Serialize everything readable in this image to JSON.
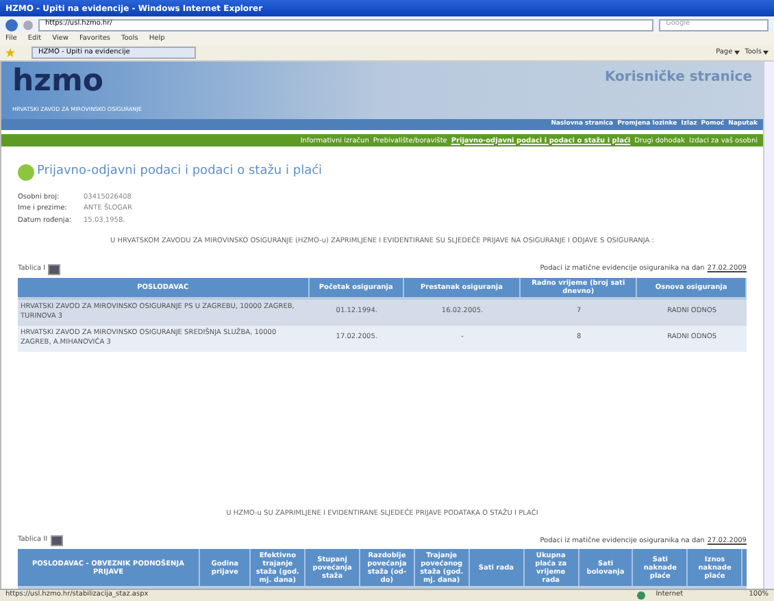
{
  "window": {
    "title": "HZMO - Upiti na evidencije - Windows Internet Explorer"
  },
  "browser": {
    "address": "https://usl.hzmo.hr/",
    "search_placeholder": "Google",
    "menu": [
      "File",
      "Edit",
      "View",
      "Favorites",
      "Tools",
      "Help"
    ],
    "tab": "HZMO - Upiti na evidencije",
    "tools": [
      "Page",
      "Tools"
    ]
  },
  "site": {
    "logo": "hzmo",
    "logo_subtitle": "HRVATSKI ZAVOD ZA MIROVINSKO OSIGURANJE",
    "heading": "Korisničke stranice",
    "top_nav": [
      "Naslovna stranica",
      "Promjena lozinke",
      "Izlaz",
      "Pomoć",
      "Naputak"
    ],
    "main_nav": [
      {
        "label": "Informativni izračun",
        "selected": false
      },
      {
        "label": "Prebivalište/boravište",
        "selected": false
      },
      {
        "label": "Prijavno-odjavni podaci i podaci o stažu i plaći",
        "selected": true
      },
      {
        "label": "Drugi dohodak",
        "selected": false
      },
      {
        "label": "Izdaci za vaš osobni",
        "selected": false
      }
    ]
  },
  "page": {
    "title": "Prijavno-odjavni podaci i podaci o stažu i plaći",
    "fields": [
      {
        "label": "Osobni broj:",
        "value": "03415026408"
      },
      {
        "label": "Ime i prezime:",
        "value": "ANTE ŠLOGAR"
      },
      {
        "label": "Datum rođenja:",
        "value": "15.03.1958."
      }
    ],
    "sections": [
      {
        "notice": "U HRVATSKOM ZAVODU ZA MIROVINSKO OSIGURANJE (HZMO-u) ZAPRIMLJENE I EVIDENTIRANE SU SLJEDEĆE PRIJAVE NA OSIGURANJE I ODJAVE S OSIGURANJA :",
        "table_label": "Tablica I",
        "as_of": "Podaci iz matične evidencije osiguranika na dan",
        "as_of_date": "27.02.2009",
        "columns": [
          "POSLODAVAC",
          "Početak osiguranja",
          "Prestanak osiguranja",
          "Radno vrijeme (broj sati dnevno)",
          "Osnova osiguranja"
        ],
        "rows": [
          [
            "HRVATSKI ZAVOD ZA MIROVINSKO OSIGURANJE PS U ZAGREBU, 10000 ZAGREB, TURINOVA 3",
            "01.12.1994.",
            "16.02.2005.",
            "7",
            "RADNI ODNOS"
          ],
          [
            "HRVATSKI ZAVOD ZA MIROVINSKO OSIGURANJE SREDIŠNJA SLUŽBA, 10000 ZAGREB, A.MIHANOVIĆA 3",
            "17.02.2005.",
            "-",
            "8",
            "RADNI ODNOS"
          ]
        ]
      },
      {
        "notice": "U HZMO-u SU ZAPRIMLJENE I EVIDENTIRANE SLJEDEĆE PRIJAVE PODATAKA O STAŽU I PLAĆI",
        "table_label": "Tablica II",
        "as_of": "Podaci iz matične evidencije osiguranika na dan",
        "as_of_date": "27.02.2009",
        "columns": [
          "POSLODAVAC - OBVEZNIK PODNOŠENJA PRIJAVE",
          "Godina prijave",
          "Efektivno trajanje staža (god. mj. dana)",
          "Stupanj povećanja staža",
          "Razdoblje povećanja staža (od-do)",
          "Trajanje povećanog staža (god. mj. dana)",
          "Sati rada",
          "Ukupna plaća za vrijeme rada",
          "Sati bolovanja",
          "Sati naknade plaće",
          "Iznos naknade plaće"
        ]
      }
    ]
  },
  "status_bar": {
    "url": "https://usl.hzmo.hr/stabilizacija_staz.aspx",
    "zone": "Internet",
    "zoom": "100%"
  }
}
